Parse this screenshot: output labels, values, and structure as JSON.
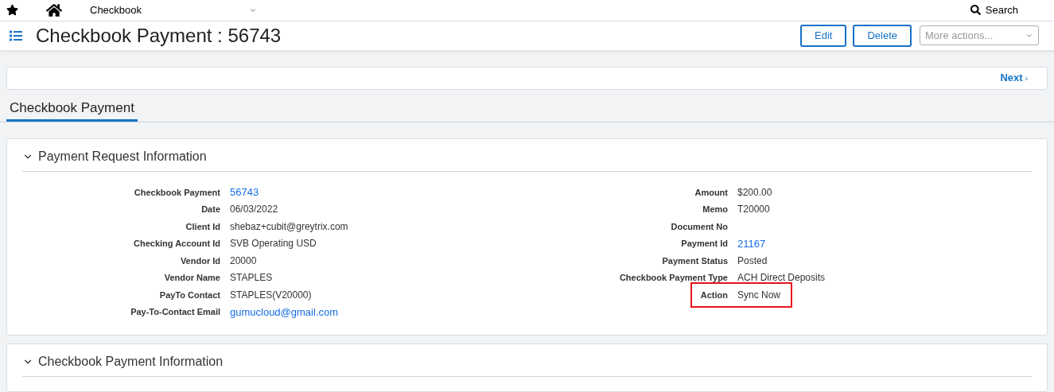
{
  "top_bar": {
    "module": "Checkbook",
    "search": "Search"
  },
  "header": {
    "title": "Checkbook Payment : 56743",
    "buttons": [
      "Edit",
      "Delete"
    ],
    "more_actions": {
      "placeholder": "More actions..."
    }
  },
  "pager": {
    "next": "Next",
    "next_glyph": "›"
  },
  "tabs": [
    {
      "label": "Checkbook Payment",
      "selected": true
    }
  ],
  "sections": [
    {
      "title": "Payment Request Information",
      "expanded": true,
      "left_fields": [
        {
          "label": "Checkbook Payment",
          "value": "56743",
          "kind": "link"
        },
        {
          "label": "Date",
          "value": "06/03/2022",
          "kind": "text"
        },
        {
          "label": "Client Id",
          "value": "shebaz+cubit@greytrix.com",
          "kind": "text"
        },
        {
          "label": "Checking Account Id",
          "value": "SVB Operating USD",
          "kind": "text"
        },
        {
          "label": "Vendor Id",
          "value": "20000",
          "kind": "text"
        },
        {
          "label": "Vendor Name",
          "value": "STAPLES",
          "kind": "text"
        },
        {
          "label": "PayTo Contact",
          "value": "STAPLES(V20000)",
          "kind": "text"
        },
        {
          "label": "Pay-To-Contact Email",
          "value": "gumucloud@gmail.com",
          "kind": "link"
        }
      ],
      "right_fields": [
        {
          "label": "Amount",
          "value": "$200.00",
          "kind": "text",
          "highlighted": false
        },
        {
          "label": "Memo",
          "value": "T20000",
          "kind": "text",
          "highlighted": false
        },
        {
          "label": "Document No",
          "kind": "text",
          "highlighted": false
        },
        {
          "label": "Payment Id",
          "value": "21167",
          "kind": "link",
          "highlighted": false
        },
        {
          "label": "Payment Status",
          "value": "Posted",
          "kind": "text",
          "highlighted": false
        },
        {
          "label": "Checkbook Payment Type",
          "value": "ACH Direct Deposits",
          "kind": "text",
          "highlighted": false
        },
        {
          "label": "Action",
          "value": "Sync Now",
          "kind": "text",
          "highlighted": true
        }
      ]
    },
    {
      "title": "Checkbook Payment Information",
      "expanded": true
    }
  ]
}
